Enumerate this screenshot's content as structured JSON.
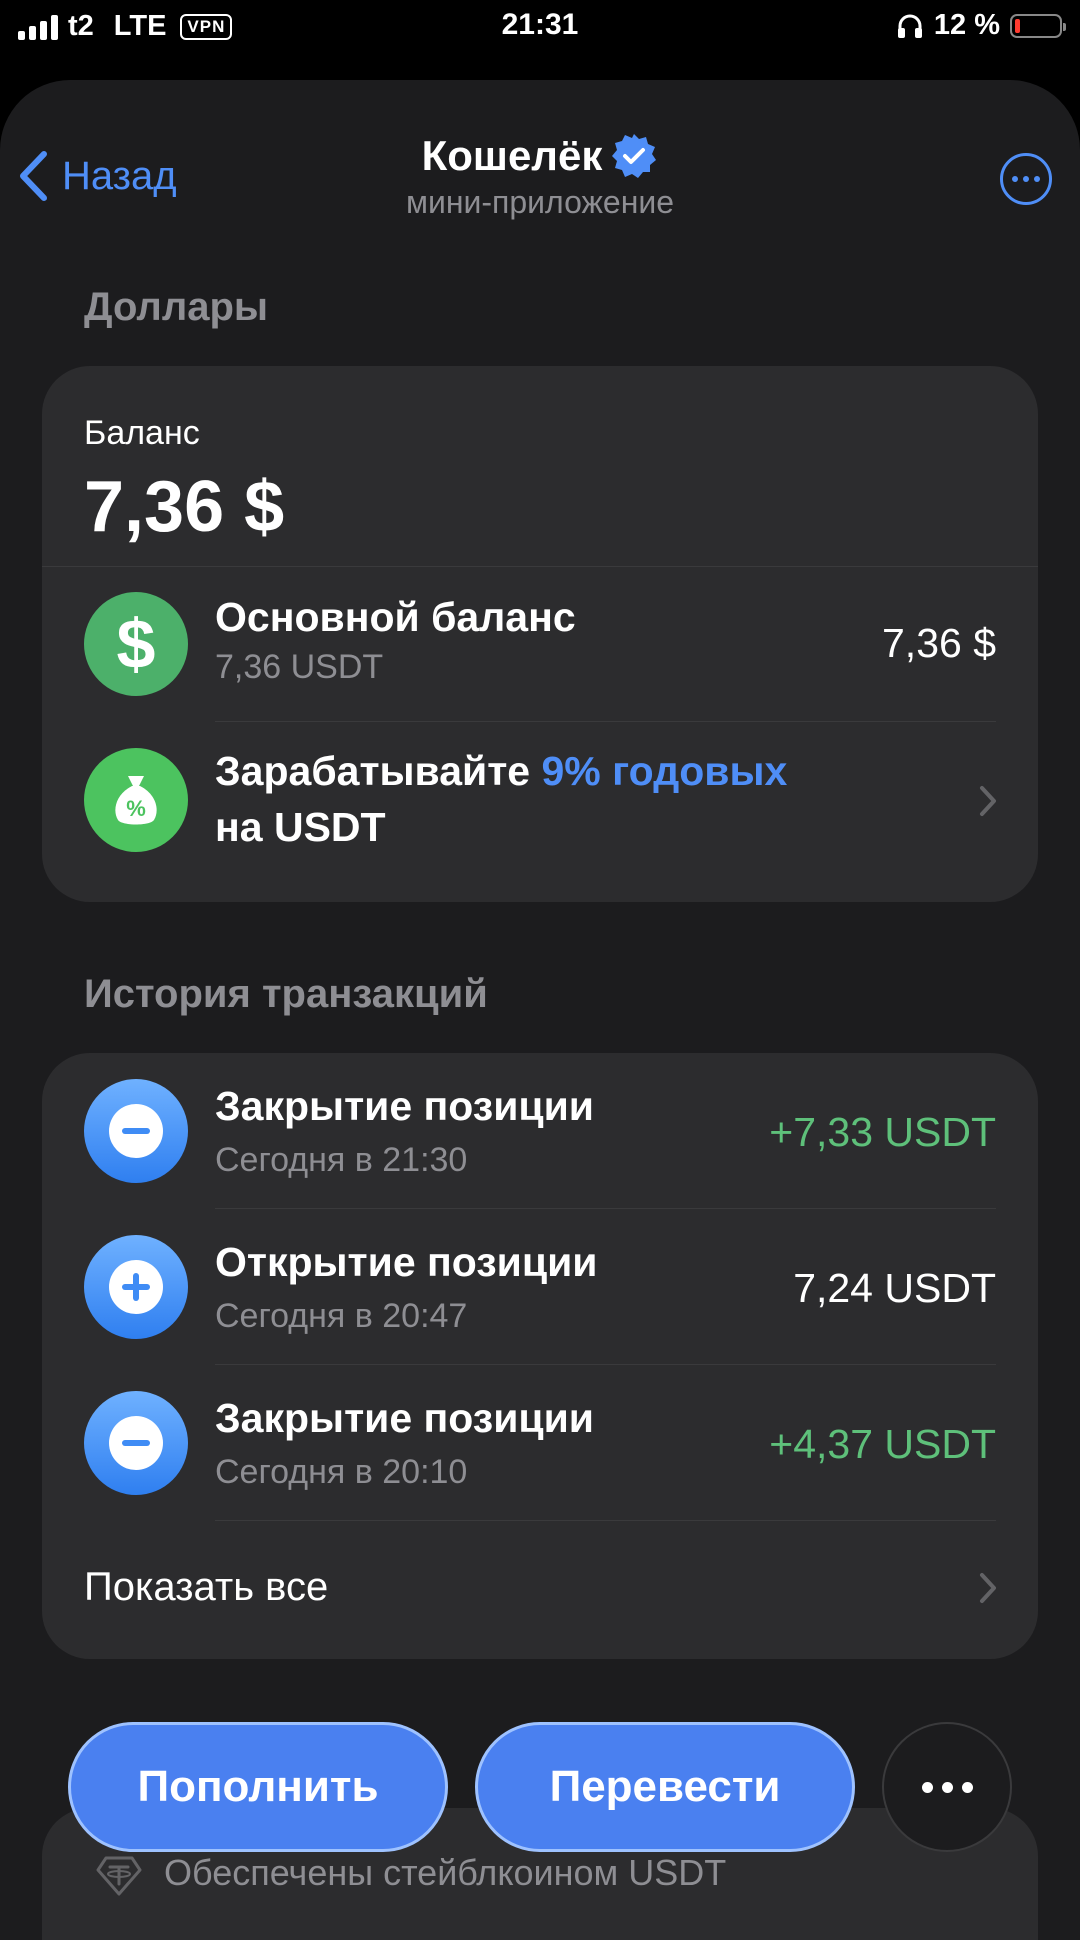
{
  "status_bar": {
    "carrier": "t2",
    "network": "LTE",
    "vpn": "VPN",
    "time": "21:31",
    "battery_text": "12 %",
    "battery_level": 0.12,
    "battery_color": "#ff3b30"
  },
  "nav": {
    "back_label": "Назад",
    "title": "Кошелёк",
    "subtitle": "мини-приложение",
    "verified_icon": "verified-badge-icon",
    "more_icon": "more-horizontal-icon"
  },
  "dollars": {
    "section_title": "Доллары",
    "balance_label": "Баланс",
    "balance_value": "7,36 $",
    "main_balance": {
      "title": "Основной баланс",
      "subtitle": "7,36 USDT",
      "amount": "7,36 $",
      "icon": "dollar-icon",
      "icon_color": "#4cb06a"
    },
    "earn": {
      "prefix": "Зарабатывайте ",
      "highlight": "9% годовых",
      "line2": "на USDT",
      "icon": "money-bag-percent-icon",
      "icon_color": "#4cc35f"
    }
  },
  "history": {
    "section_title": "История транзакций",
    "items": [
      {
        "title": "Закрытие позиции",
        "time": "Сегодня в 21:30",
        "amount": "+7,33 USDT",
        "positive": true,
        "icon": "minus-circle-icon"
      },
      {
        "title": "Открытие позиции",
        "time": "Сегодня в 20:47",
        "amount": "7,24 USDT",
        "positive": false,
        "icon": "plus-circle-icon"
      },
      {
        "title": "Закрытие позиции",
        "time": "Сегодня в 20:10",
        "amount": "+4,37 USDT",
        "positive": true,
        "icon": "minus-circle-icon"
      }
    ],
    "show_all": "Показать все"
  },
  "actions": {
    "deposit": "Пополнить",
    "transfer": "Перевести",
    "more_icon": "more-horizontal-icon"
  },
  "footer": {
    "text": "Обеспечены стейблкоином USDT",
    "icon": "tether-icon"
  },
  "colors": {
    "accent": "#4f8ef7",
    "positive": "#5ec07a",
    "card_bg": "#2c2c2e",
    "sheet_bg": "#1c1c1e"
  }
}
